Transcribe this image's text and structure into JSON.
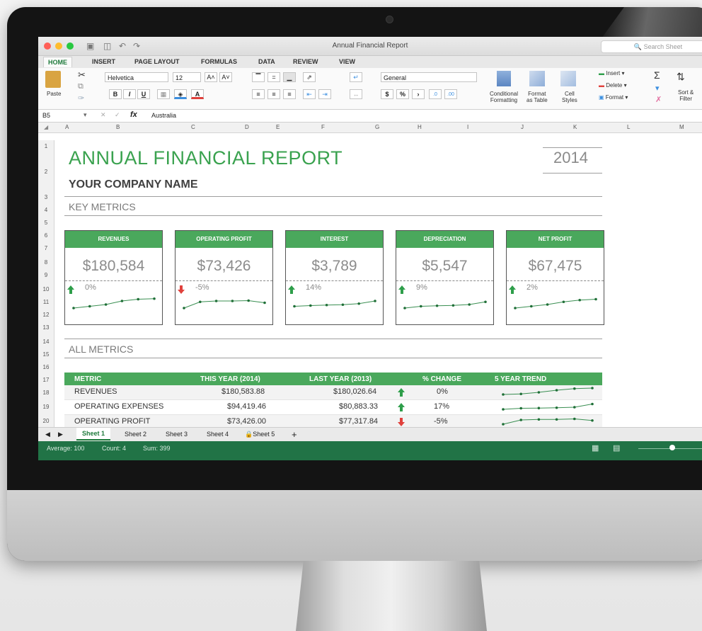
{
  "window": {
    "title": "Annual Financial Report",
    "search_placeholder": "Search Sheet"
  },
  "tabs": [
    "HOME",
    "INSERT",
    "PAGE LAYOUT",
    "FORMULAS",
    "DATA",
    "REVIEW",
    "VIEW"
  ],
  "ribbon": {
    "paste": "Paste",
    "font": "Helvetica",
    "size": "12",
    "number_format": "General",
    "conditional": [
      "Conditional",
      "Formatting"
    ],
    "format_table": [
      "Format",
      "as Table"
    ],
    "cell_styles": [
      "Cell",
      "Styles"
    ],
    "insert": "Insert",
    "delete": "Delete",
    "format": "Format",
    "sort": [
      "Sort &",
      "Filter"
    ],
    "bold": "B",
    "italic": "I",
    "underline": "U",
    "currency": "$",
    "percent": "%",
    "comma": "›"
  },
  "formula_bar": {
    "cell": "B5",
    "fx": "fx",
    "value": "Australia"
  },
  "columns": [
    "A",
    "B",
    "C",
    "D",
    "E",
    "F",
    "G",
    "H",
    "I",
    "J",
    "K",
    "L",
    "M"
  ],
  "rows": [
    "1",
    "2",
    "3",
    "4",
    "5",
    "6",
    "7",
    "8",
    "9",
    "10",
    "11",
    "12",
    "13",
    "14",
    "15",
    "16",
    "17",
    "18",
    "19",
    "20"
  ],
  "report": {
    "title": "ANNUAL  FINANCIAL  REPORT",
    "year": "2014",
    "company": "YOUR COMPANY NAME",
    "key_metrics": "KEY METRICS",
    "all_metrics": "ALL METRICS"
  },
  "cards": [
    {
      "label": "REVENUES",
      "value": "$180,584",
      "change": "0%",
      "trend": "up",
      "spark": [
        2,
        3,
        4,
        6,
        7,
        7.3
      ]
    },
    {
      "label": "OPERATING PROFIT",
      "value": "$73,426",
      "change": "-5%",
      "trend": "down",
      "spark": [
        2,
        5.5,
        6,
        6,
        6.2,
        5
      ]
    },
    {
      "label": "INTEREST",
      "value": "$3,789",
      "change": "14%",
      "trend": "up",
      "spark": [
        3,
        3.4,
        3.7,
        3.9,
        4.5,
        6
      ]
    },
    {
      "label": "DEPRECIATION",
      "value": "$5,547",
      "change": "9%",
      "trend": "up",
      "spark": [
        2,
        3,
        3.3,
        3.5,
        4,
        5.5
      ]
    },
    {
      "label": "NET PROFIT",
      "value": "$67,475",
      "change": "2%",
      "trend": "up",
      "spark": [
        2,
        3,
        4,
        5.5,
        6.5,
        7
      ]
    }
  ],
  "table": {
    "headers": [
      "METRIC",
      "THIS YEAR (2014)",
      "LAST YEAR (2013)",
      "% CHANGE",
      "5 YEAR TREND"
    ],
    "rows": [
      {
        "metric": "REVENUES",
        "this_year": "$180,583.88",
        "last_year": "$180,026.64",
        "trend": "up",
        "change": "0%",
        "spark": [
          2,
          2.5,
          4,
          6,
          7.5,
          8
        ]
      },
      {
        "metric": "OPERATING  EXPENSES",
        "this_year": "$94,419.46",
        "last_year": "$80,883.33",
        "trend": "up",
        "change": "17%",
        "spark": [
          2,
          3,
          3.2,
          3.5,
          4,
          7
        ]
      },
      {
        "metric": "OPERATING  PROFIT",
        "this_year": "$73,426.00",
        "last_year": "$77,317.84",
        "trend": "down",
        "change": "-5%",
        "spark": [
          2,
          6,
          6.5,
          6.5,
          7,
          5.5
        ]
      }
    ]
  },
  "sheets": [
    "Sheet 1",
    "Sheet 2",
    "Sheet 3",
    "Sheet 4",
    "Sheet 5"
  ],
  "sheet_add": "+",
  "status": {
    "average": "Average: 100",
    "count": "Count: 4",
    "sum": "Sum: 399"
  },
  "colors": {
    "accent": "#4aa85c",
    "status_bar": "#217346",
    "up": "#2e9e4a",
    "down": "#e0413c"
  }
}
